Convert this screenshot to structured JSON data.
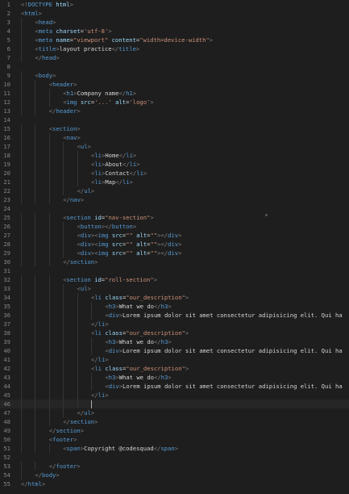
{
  "colors": {
    "background": "#1e1e1e",
    "tag": "#569cd6",
    "bracket": "#808080",
    "attr": "#9cdcfe",
    "string": "#ce9178",
    "text": "#d4d4d4",
    "line_number": "#858585"
  },
  "active_line": 46,
  "lines": [
    {
      "n": 1,
      "indent": 0,
      "tokens": [
        [
          "b",
          "<!"
        ],
        [
          "t",
          "DOCTYPE "
        ],
        [
          "a",
          "html"
        ],
        [
          "b",
          ">"
        ]
      ]
    },
    {
      "n": 2,
      "indent": 0,
      "tokens": [
        [
          "b",
          "<"
        ],
        [
          "t",
          "html"
        ],
        [
          "b",
          ">"
        ]
      ]
    },
    {
      "n": 3,
      "indent": 1,
      "tokens": [
        [
          "b",
          "<"
        ],
        [
          "t",
          "head"
        ],
        [
          "b",
          ">"
        ]
      ]
    },
    {
      "n": 4,
      "indent": 1,
      "tokens": [
        [
          "b",
          "<"
        ],
        [
          "t",
          "meta "
        ],
        [
          "a",
          "charset"
        ],
        [
          "x",
          "="
        ],
        [
          "s",
          "'utf-8'"
        ],
        [
          "b",
          ">"
        ]
      ]
    },
    {
      "n": 5,
      "indent": 1,
      "tokens": [
        [
          "b",
          "<"
        ],
        [
          "t",
          "meta "
        ],
        [
          "a",
          "name"
        ],
        [
          "x",
          "="
        ],
        [
          "s",
          "\"viewport\""
        ],
        [
          "x",
          " "
        ],
        [
          "a",
          "content"
        ],
        [
          "x",
          "="
        ],
        [
          "s",
          "\"width=device-width\""
        ],
        [
          "b",
          ">"
        ]
      ]
    },
    {
      "n": 6,
      "indent": 1,
      "tokens": [
        [
          "b",
          "<"
        ],
        [
          "t",
          "title"
        ],
        [
          "b",
          ">"
        ],
        [
          "x",
          "layout practice"
        ],
        [
          "b",
          "</"
        ],
        [
          "t",
          "title"
        ],
        [
          "b",
          ">"
        ]
      ]
    },
    {
      "n": 7,
      "indent": 1,
      "tokens": [
        [
          "b",
          "</"
        ],
        [
          "t",
          "head"
        ],
        [
          "b",
          ">"
        ]
      ]
    },
    {
      "n": 8,
      "indent": 0,
      "tokens": []
    },
    {
      "n": 9,
      "indent": 1,
      "tokens": [
        [
          "b",
          "<"
        ],
        [
          "t",
          "body"
        ],
        [
          "b",
          ">"
        ]
      ]
    },
    {
      "n": 10,
      "indent": 2,
      "tokens": [
        [
          "b",
          "<"
        ],
        [
          "t",
          "header"
        ],
        [
          "b",
          ">"
        ]
      ]
    },
    {
      "n": 11,
      "indent": 3,
      "tokens": [
        [
          "b",
          "<"
        ],
        [
          "t",
          "h1"
        ],
        [
          "b",
          ">"
        ],
        [
          "x",
          "Company name"
        ],
        [
          "b",
          "</"
        ],
        [
          "t",
          "h1"
        ],
        [
          "b",
          ">"
        ]
      ]
    },
    {
      "n": 12,
      "indent": 3,
      "tokens": [
        [
          "b",
          "<"
        ],
        [
          "t",
          "img "
        ],
        [
          "a",
          "src"
        ],
        [
          "x",
          "="
        ],
        [
          "s",
          "'...'"
        ],
        [
          "x",
          " "
        ],
        [
          "a",
          "alt"
        ],
        [
          "x",
          "="
        ],
        [
          "s",
          "'logo'"
        ],
        [
          "b",
          ">"
        ]
      ]
    },
    {
      "n": 13,
      "indent": 2,
      "tokens": [
        [
          "b",
          "</"
        ],
        [
          "t",
          "header"
        ],
        [
          "b",
          ">"
        ]
      ]
    },
    {
      "n": 14,
      "indent": 0,
      "tokens": []
    },
    {
      "n": 15,
      "indent": 2,
      "tokens": [
        [
          "b",
          "<"
        ],
        [
          "t",
          "section"
        ],
        [
          "b",
          ">"
        ]
      ]
    },
    {
      "n": 16,
      "indent": 3,
      "tokens": [
        [
          "b",
          "<"
        ],
        [
          "t",
          "nav"
        ],
        [
          "b",
          ">"
        ]
      ]
    },
    {
      "n": 17,
      "indent": 4,
      "tokens": [
        [
          "b",
          "<"
        ],
        [
          "t",
          "ul"
        ],
        [
          "b",
          ">"
        ]
      ]
    },
    {
      "n": 18,
      "indent": 5,
      "tokens": [
        [
          "b",
          "<"
        ],
        [
          "t",
          "li"
        ],
        [
          "b",
          ">"
        ],
        [
          "x",
          "Home"
        ],
        [
          "b",
          "</"
        ],
        [
          "t",
          "li"
        ],
        [
          "b",
          ">"
        ]
      ]
    },
    {
      "n": 19,
      "indent": 5,
      "tokens": [
        [
          "b",
          "<"
        ],
        [
          "t",
          "li"
        ],
        [
          "b",
          ">"
        ],
        [
          "x",
          "About"
        ],
        [
          "b",
          "</"
        ],
        [
          "t",
          "li"
        ],
        [
          "b",
          ">"
        ]
      ]
    },
    {
      "n": 20,
      "indent": 5,
      "tokens": [
        [
          "b",
          "<"
        ],
        [
          "t",
          "li"
        ],
        [
          "b",
          ">"
        ],
        [
          "x",
          "Contact"
        ],
        [
          "b",
          "</"
        ],
        [
          "t",
          "li"
        ],
        [
          "b",
          ">"
        ]
      ]
    },
    {
      "n": 21,
      "indent": 5,
      "tokens": [
        [
          "b",
          "<"
        ],
        [
          "t",
          "li"
        ],
        [
          "b",
          ">"
        ],
        [
          "x",
          "Map"
        ],
        [
          "b",
          "</"
        ],
        [
          "t",
          "li"
        ],
        [
          "b",
          ">"
        ]
      ]
    },
    {
      "n": 22,
      "indent": 4,
      "tokens": [
        [
          "b",
          "</"
        ],
        [
          "t",
          "ul"
        ],
        [
          "b",
          ">"
        ]
      ]
    },
    {
      "n": 23,
      "indent": 3,
      "tokens": [
        [
          "b",
          "</"
        ],
        [
          "t",
          "nav"
        ],
        [
          "b",
          ">"
        ]
      ]
    },
    {
      "n": 24,
      "indent": 0,
      "tokens": []
    },
    {
      "n": 25,
      "indent": 3,
      "tokens": [
        [
          "b",
          "<"
        ],
        [
          "t",
          "section "
        ],
        [
          "a",
          "id"
        ],
        [
          "x",
          "="
        ],
        [
          "s",
          "\"nav-section\""
        ],
        [
          "b",
          ">"
        ]
      ]
    },
    {
      "n": 26,
      "indent": 4,
      "tokens": [
        [
          "b",
          "<"
        ],
        [
          "t",
          "button"
        ],
        [
          "b",
          "></"
        ],
        [
          "t",
          "button"
        ],
        [
          "b",
          ">"
        ]
      ]
    },
    {
      "n": 27,
      "indent": 4,
      "tokens": [
        [
          "b",
          "<"
        ],
        [
          "t",
          "div"
        ],
        [
          "b",
          "><"
        ],
        [
          "t",
          "img "
        ],
        [
          "a",
          "src"
        ],
        [
          "x",
          "="
        ],
        [
          "s",
          "\"\""
        ],
        [
          "x",
          " "
        ],
        [
          "a",
          "alt"
        ],
        [
          "x",
          "="
        ],
        [
          "s",
          "\"\""
        ],
        [
          "b",
          "></"
        ],
        [
          "t",
          "div"
        ],
        [
          "b",
          ">"
        ]
      ]
    },
    {
      "n": 28,
      "indent": 4,
      "tokens": [
        [
          "b",
          "<"
        ],
        [
          "t",
          "div"
        ],
        [
          "b",
          "><"
        ],
        [
          "t",
          "img "
        ],
        [
          "a",
          "src"
        ],
        [
          "x",
          "="
        ],
        [
          "s",
          "\"\""
        ],
        [
          "x",
          " "
        ],
        [
          "a",
          "alt"
        ],
        [
          "x",
          "="
        ],
        [
          "s",
          "\"\""
        ],
        [
          "b",
          "></"
        ],
        [
          "t",
          "div"
        ],
        [
          "b",
          ">"
        ]
      ]
    },
    {
      "n": 29,
      "indent": 4,
      "tokens": [
        [
          "b",
          "<"
        ],
        [
          "t",
          "div"
        ],
        [
          "b",
          "><"
        ],
        [
          "t",
          "img "
        ],
        [
          "a",
          "src"
        ],
        [
          "x",
          "="
        ],
        [
          "s",
          "\"\""
        ],
        [
          "x",
          " "
        ],
        [
          "a",
          "alt"
        ],
        [
          "x",
          "="
        ],
        [
          "s",
          "\"\""
        ],
        [
          "b",
          "></"
        ],
        [
          "t",
          "div"
        ],
        [
          "b",
          ">"
        ]
      ]
    },
    {
      "n": 30,
      "indent": 3,
      "tokens": [
        [
          "b",
          "</"
        ],
        [
          "t",
          "section"
        ],
        [
          "b",
          ">"
        ]
      ]
    },
    {
      "n": 31,
      "indent": 0,
      "tokens": []
    },
    {
      "n": 32,
      "indent": 3,
      "tokens": [
        [
          "b",
          "<"
        ],
        [
          "t",
          "section "
        ],
        [
          "a",
          "id"
        ],
        [
          "x",
          "="
        ],
        [
          "s",
          "\"roll-section\""
        ],
        [
          "b",
          ">"
        ]
      ]
    },
    {
      "n": 33,
      "indent": 4,
      "tokens": [
        [
          "b",
          "<"
        ],
        [
          "t",
          "ul"
        ],
        [
          "b",
          ">"
        ]
      ]
    },
    {
      "n": 34,
      "indent": 5,
      "tokens": [
        [
          "b",
          "<"
        ],
        [
          "t",
          "li "
        ],
        [
          "a",
          "class"
        ],
        [
          "x",
          "="
        ],
        [
          "s",
          "\"our_description\""
        ],
        [
          "b",
          ">"
        ]
      ]
    },
    {
      "n": 35,
      "indent": 6,
      "tokens": [
        [
          "b",
          "<"
        ],
        [
          "t",
          "h3"
        ],
        [
          "b",
          ">"
        ],
        [
          "x",
          "What we do"
        ],
        [
          "b",
          "</"
        ],
        [
          "t",
          "h3"
        ],
        [
          "b",
          ">"
        ]
      ]
    },
    {
      "n": 36,
      "indent": 6,
      "tokens": [
        [
          "b",
          "<"
        ],
        [
          "t",
          "div"
        ],
        [
          "b",
          ">"
        ],
        [
          "x",
          "Lorem ipsum dolor sit amet consectetur adipisicing elit. Qui ha"
        ]
      ]
    },
    {
      "n": 37,
      "indent": 5,
      "tokens": [
        [
          "b",
          "</"
        ],
        [
          "t",
          "li"
        ],
        [
          "b",
          ">"
        ]
      ]
    },
    {
      "n": 38,
      "indent": 5,
      "tokens": [
        [
          "b",
          "<"
        ],
        [
          "t",
          "li "
        ],
        [
          "a",
          "class"
        ],
        [
          "x",
          "="
        ],
        [
          "s",
          "\"our_description\""
        ],
        [
          "b",
          ">"
        ]
      ]
    },
    {
      "n": 39,
      "indent": 6,
      "tokens": [
        [
          "b",
          "<"
        ],
        [
          "t",
          "h3"
        ],
        [
          "b",
          ">"
        ],
        [
          "x",
          "What we do"
        ],
        [
          "b",
          "</"
        ],
        [
          "t",
          "h3"
        ],
        [
          "b",
          ">"
        ]
      ]
    },
    {
      "n": 40,
      "indent": 6,
      "tokens": [
        [
          "b",
          "<"
        ],
        [
          "t",
          "div"
        ],
        [
          "b",
          ">"
        ],
        [
          "x",
          "Lorem ipsum dolor sit amet consectetur adipisicing elit. Qui ha"
        ]
      ]
    },
    {
      "n": 41,
      "indent": 5,
      "tokens": [
        [
          "b",
          "</"
        ],
        [
          "t",
          "li"
        ],
        [
          "b",
          ">"
        ]
      ]
    },
    {
      "n": 42,
      "indent": 5,
      "tokens": [
        [
          "b",
          "<"
        ],
        [
          "t",
          "li "
        ],
        [
          "a",
          "class"
        ],
        [
          "x",
          "="
        ],
        [
          "s",
          "\"our_description\""
        ],
        [
          "b",
          ">"
        ]
      ]
    },
    {
      "n": 43,
      "indent": 6,
      "tokens": [
        [
          "b",
          "<"
        ],
        [
          "t",
          "h3"
        ],
        [
          "b",
          ">"
        ],
        [
          "x",
          "What we do"
        ],
        [
          "b",
          "</"
        ],
        [
          "t",
          "h3"
        ],
        [
          "b",
          ">"
        ]
      ]
    },
    {
      "n": 44,
      "indent": 6,
      "tokens": [
        [
          "b",
          "<"
        ],
        [
          "t",
          "div"
        ],
        [
          "b",
          ">"
        ],
        [
          "x",
          "Lorem ipsum dolor sit amet consectetur adipisicing elit. Qui ha"
        ]
      ]
    },
    {
      "n": 45,
      "indent": 5,
      "tokens": [
        [
          "b",
          "</"
        ],
        [
          "t",
          "li"
        ],
        [
          "b",
          ">"
        ]
      ]
    },
    {
      "n": 46,
      "indent": 5,
      "tokens": []
    },
    {
      "n": 47,
      "indent": 4,
      "tokens": [
        [
          "b",
          "</"
        ],
        [
          "t",
          "ul"
        ],
        [
          "b",
          ">"
        ]
      ]
    },
    {
      "n": 48,
      "indent": 3,
      "tokens": [
        [
          "b",
          "</"
        ],
        [
          "t",
          "section"
        ],
        [
          "b",
          ">"
        ]
      ]
    },
    {
      "n": 49,
      "indent": 2,
      "tokens": [
        [
          "b",
          "</"
        ],
        [
          "t",
          "section"
        ],
        [
          "b",
          ">"
        ]
      ]
    },
    {
      "n": 50,
      "indent": 2,
      "tokens": [
        [
          "b",
          "<"
        ],
        [
          "t",
          "footer"
        ],
        [
          "b",
          ">"
        ]
      ]
    },
    {
      "n": 51,
      "indent": 3,
      "tokens": [
        [
          "b",
          "<"
        ],
        [
          "t",
          "span"
        ],
        [
          "b",
          ">"
        ],
        [
          "x",
          "Copyright @codesquad"
        ],
        [
          "b",
          "</"
        ],
        [
          "t",
          "span"
        ],
        [
          "b",
          ">"
        ]
      ]
    },
    {
      "n": 52,
      "indent": 0,
      "tokens": []
    },
    {
      "n": 53,
      "indent": 2,
      "tokens": [
        [
          "b",
          "</"
        ],
        [
          "t",
          "footer"
        ],
        [
          "b",
          ">"
        ]
      ]
    },
    {
      "n": 54,
      "indent": 1,
      "tokens": [
        [
          "b",
          "</"
        ],
        [
          "t",
          "body"
        ],
        [
          "b",
          ">"
        ]
      ]
    },
    {
      "n": 55,
      "indent": 0,
      "tokens": [
        [
          "b",
          "</"
        ],
        [
          "t",
          "html"
        ],
        [
          "b",
          ">"
        ]
      ]
    }
  ]
}
